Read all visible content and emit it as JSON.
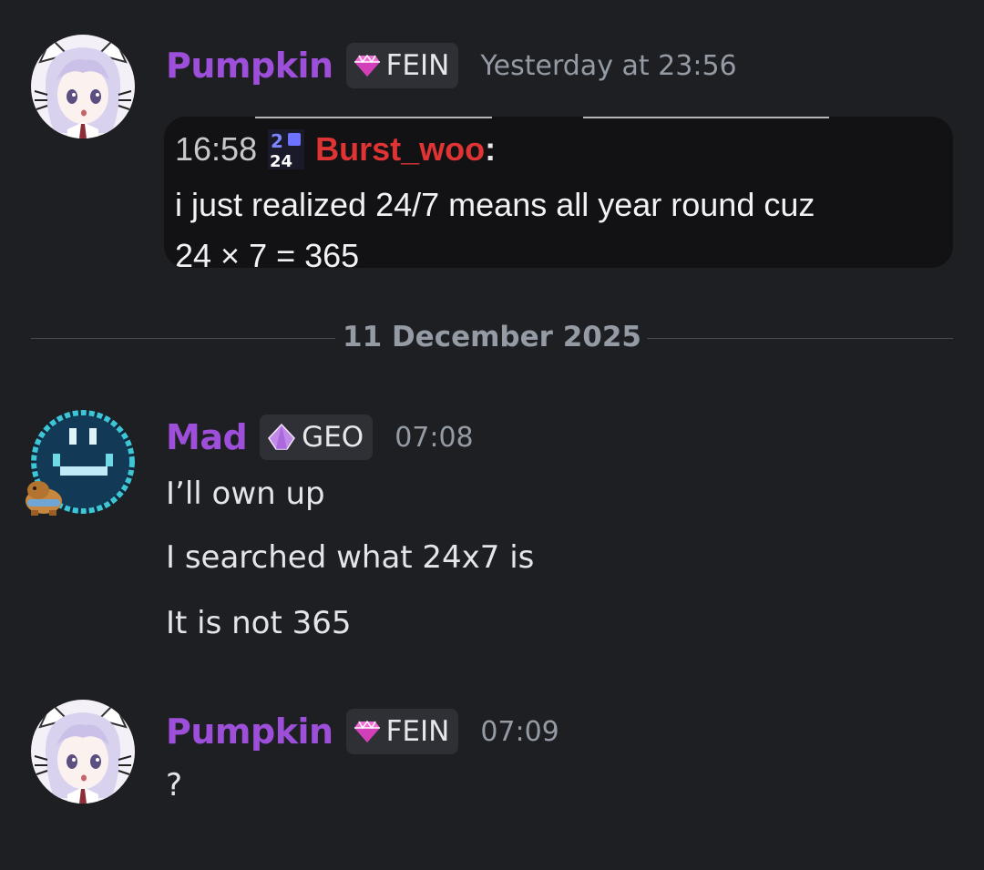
{
  "messages": [
    {
      "username": "Pumpkin",
      "tag_label": "FEIN",
      "tag_icon": "gem-icon",
      "timestamp": "Yesterday at 23:56",
      "embed": {
        "time": "16:58",
        "badge_top": "2",
        "badge_bottom": "24",
        "user": "Burst_woo",
        "colon": ":",
        "line1": "i just realized 24/7 means all year round cuz",
        "line2": "24 × 7 = 365"
      }
    },
    {
      "username": "Mad",
      "tag_label": "GEO",
      "tag_icon": "crystal-icon",
      "timestamp": "07:08",
      "lines": [
        "I’ll own up",
        "I searched what 24x7 is",
        "It is not 365"
      ]
    },
    {
      "username": "Pumpkin",
      "tag_label": "FEIN",
      "tag_icon": "gem-icon",
      "timestamp": "07:09",
      "lines": [
        "?"
      ]
    }
  ],
  "divider": {
    "date": "11 December 2025"
  },
  "colors": {
    "background": "#1e1f22",
    "username": "#9d4fd9",
    "tag_bg": "#2e3035",
    "timestamp": "#949ba4",
    "text": "#e3e5e8",
    "embed_user": "#e03434"
  }
}
